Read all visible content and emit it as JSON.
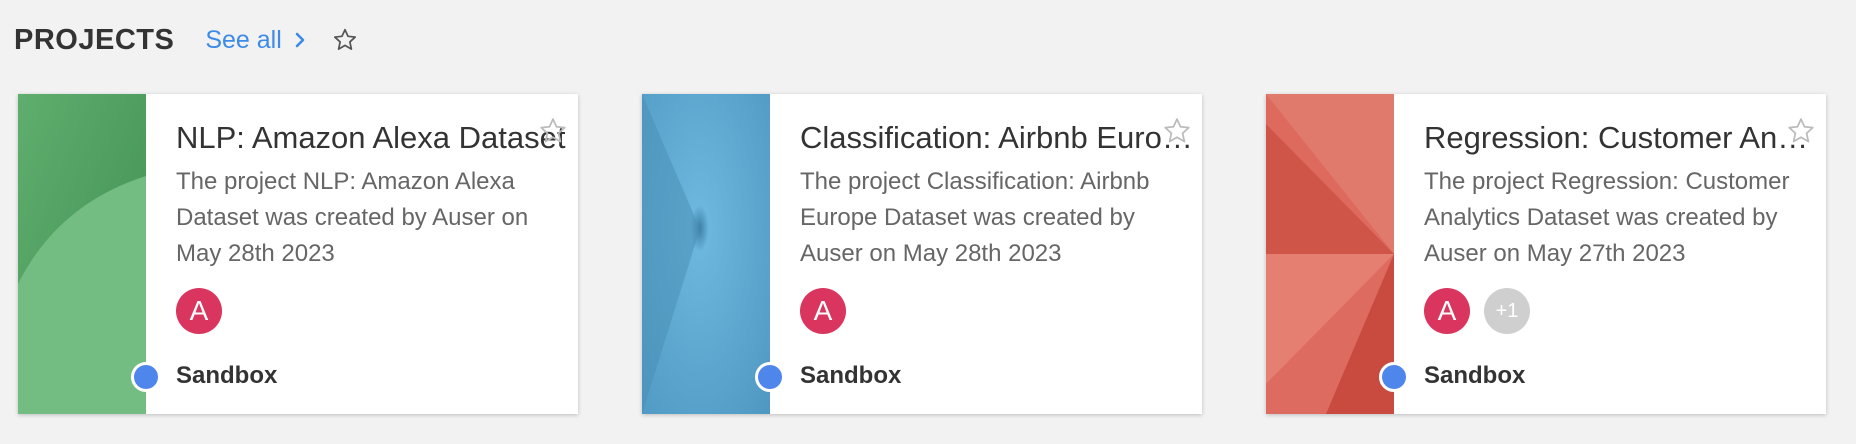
{
  "header": {
    "title": "PROJECTS",
    "see_all_label": "See all",
    "star_icon": "star-outline-icon"
  },
  "colors": {
    "link": "#3d8be6",
    "avatar": "#d9355e",
    "status_dot": "#4f86ec",
    "card1_thumb": "#6ab57b",
    "card2_thumb": "#5aa6cf",
    "card3_thumb": "#df6a5e"
  },
  "projects": [
    {
      "title": "NLP: Amazon Alexa Dataset",
      "description": "The project NLP: Amazon Alexa Dataset was created by Auser on May 28th 2023",
      "members": [
        "A"
      ],
      "extra_members": "",
      "environment": "Sandbox"
    },
    {
      "title": "Classification: Airbnb Europe Dataset",
      "description": "The project Classification: Airbnb Europe Dataset was created by Auser on May 28th 2023",
      "members": [
        "A"
      ],
      "extra_members": "",
      "environment": "Sandbox"
    },
    {
      "title": "Regression: Customer Analytics Dataset",
      "description": "The project Regression: Customer Analytics Dataset was created by Auser on May 27th 2023",
      "members": [
        "A"
      ],
      "extra_members": "+1",
      "environment": "Sandbox"
    }
  ]
}
